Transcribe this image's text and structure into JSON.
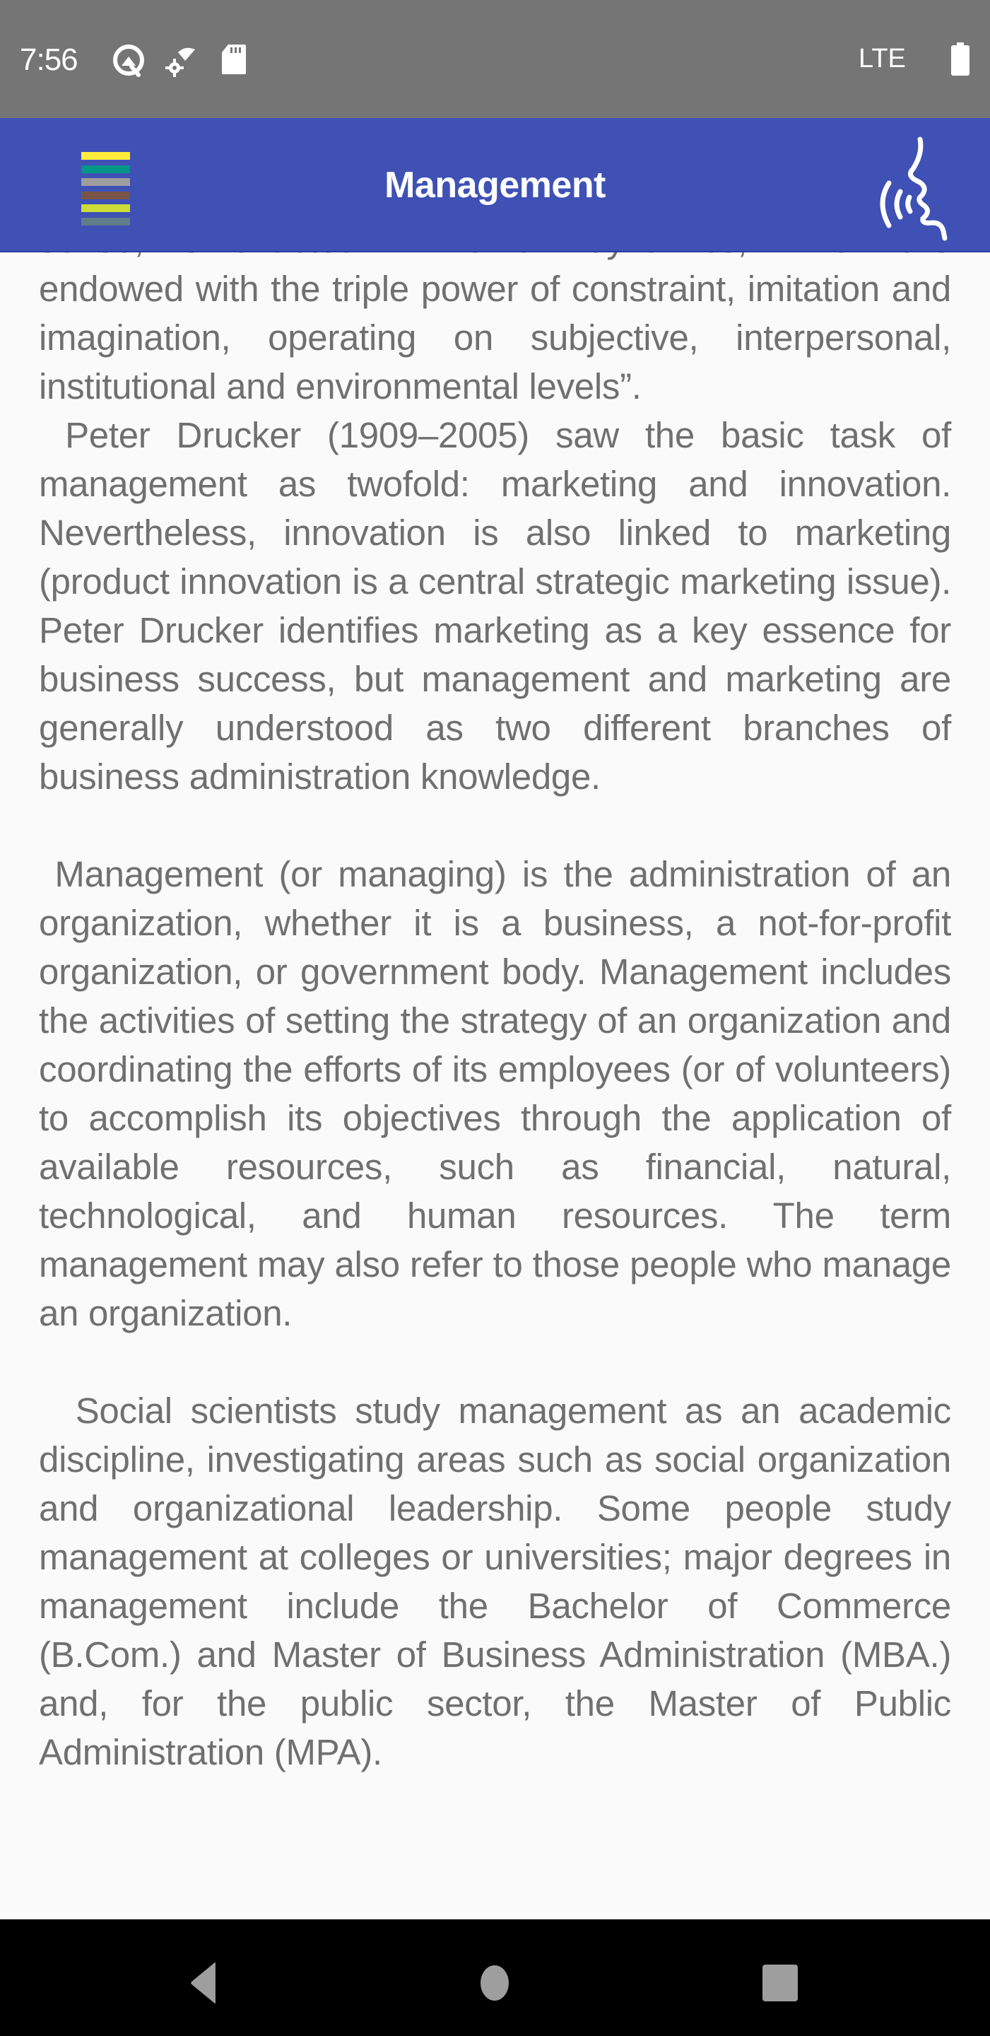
{
  "status_bar": {
    "time": "7:56",
    "icons": [
      "android-q-icon",
      "data-saver-icon",
      "sd-card-icon"
    ],
    "network": "LTE",
    "battery_icon": "battery-full-icon"
  },
  "app_bar": {
    "title": "Management",
    "menu_icon": "colored-menu-icon",
    "menu_stripe_colors": [
      "#ffeb3b",
      "#009688",
      "#9e9e9e",
      "#795548",
      "#cddc39",
      "#607d8b"
    ],
    "speak_icon": "text-to-speech-icon",
    "background_color": "#3f51b5"
  },
  "content": {
    "text_color": "#707070",
    "paragraphs": [
      "sense, is enacted in human dynamics, which are endowed with the triple power of constraint, imitation and imagination, operating on subjective, interpersonal, institutional and environmental levels”.",
      " Peter Drucker (1909–2005) saw the basic task of management as twofold: marketing and innovation. Nevertheless, innovation is also linked to marketing (product innovation is a central strategic marketing issue). Peter Drucker identifies marketing as a key essence for business success, but management and marketing are generally understood as two different branches of business administration knowledge.",
      " Management (or managing) is the administration of an organization, whether it is a business, a not-for-profit organization, or government body. Management includes the activities of setting the strategy of an organization and coordinating the efforts of its employees (or of volunteers) to accomplish its objectives through the application of available resources, such as financial, natural, technological, and human resources. The term management may also refer to those people who manage an organization.",
      "  Social scientists study management as an academic discipline, investigating areas such as social organization and organizational leadership. Some people study management at colleges or universities; major degrees in management include the Bachelor of Commerce (B.Com.) and Master of Business Administration (MBA.) and, for the public sector, the Master of Public Administration (MPA)."
    ]
  },
  "nav_bar": {
    "back_icon": "back-triangle-icon",
    "home_icon": "home-circle-icon",
    "recents_icon": "recents-square-icon"
  }
}
